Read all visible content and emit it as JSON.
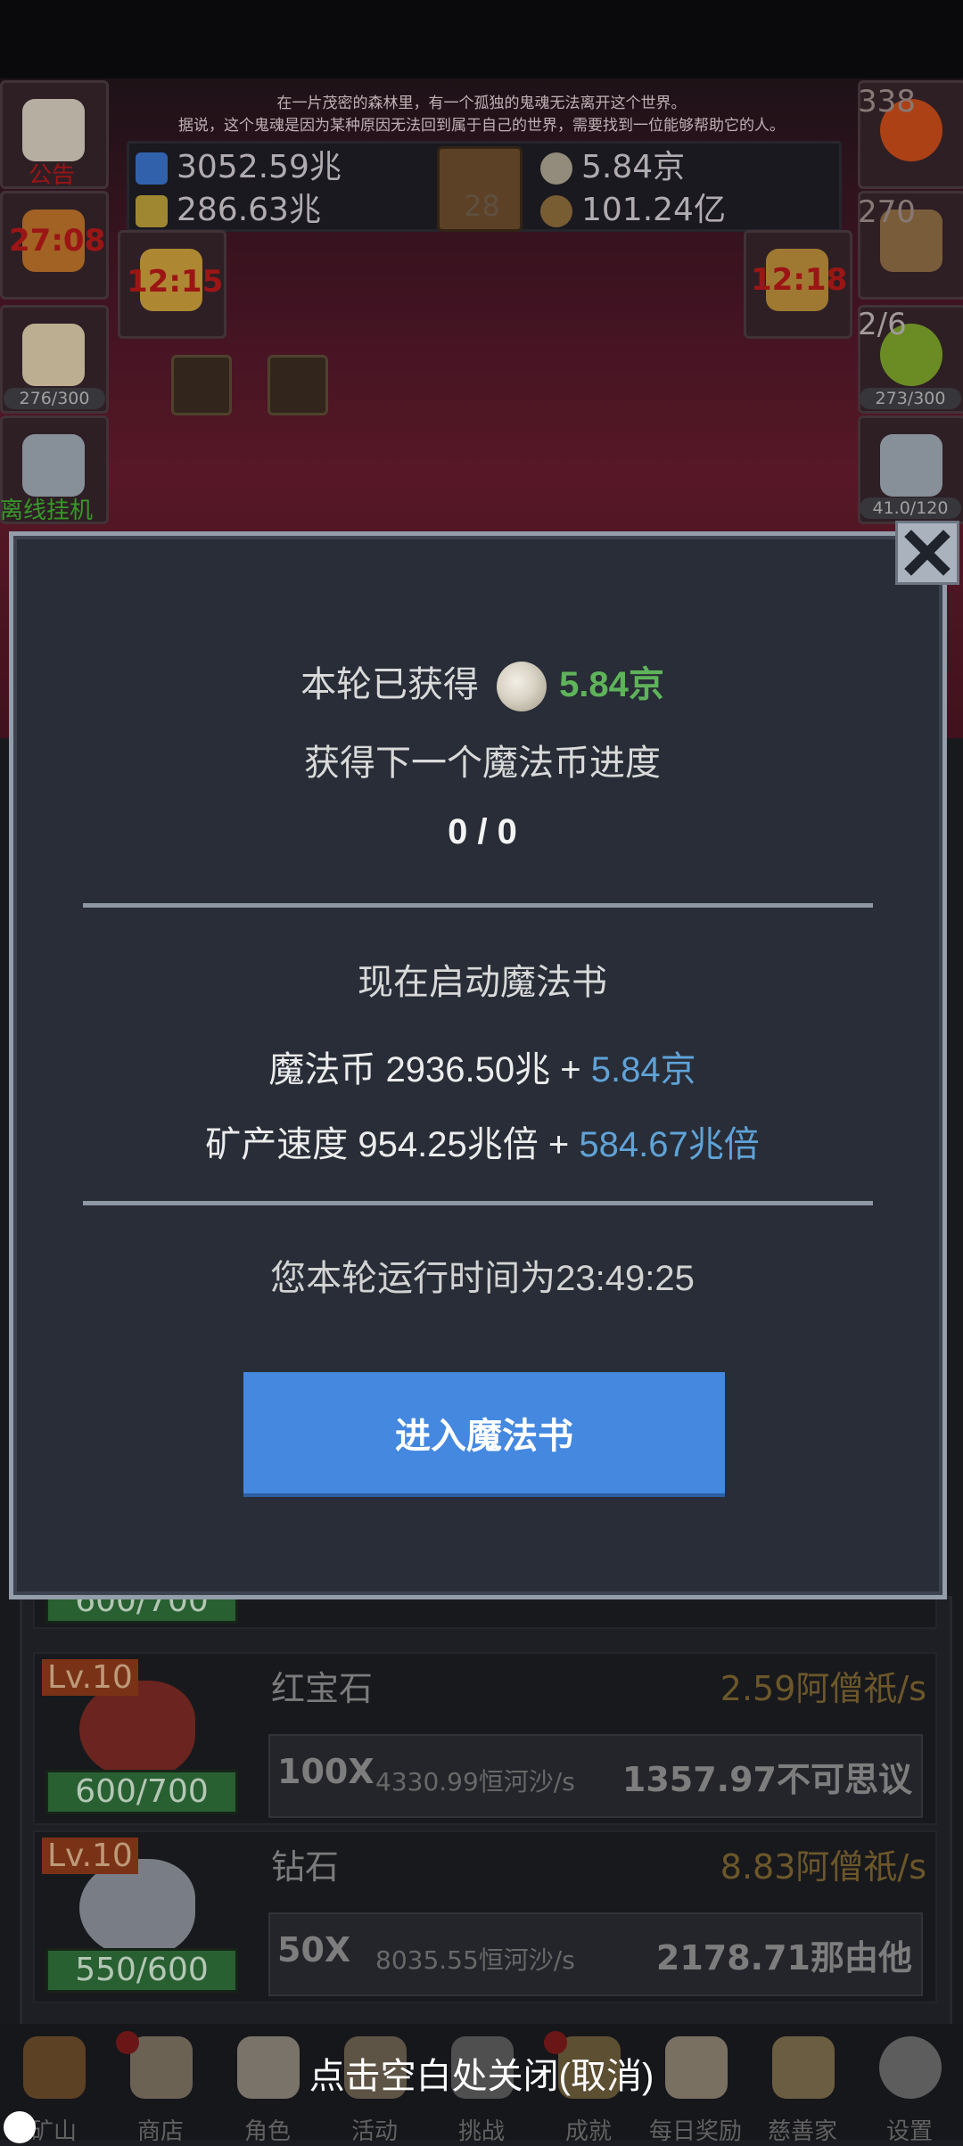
{
  "story": {
    "line1": "在一片茂密的森林里，有一个孤独的鬼魂无法离开这个世界。",
    "line2": "据说，这个鬼魂是因为某种原因无法回到属于自己的世界，需要找到一位能够帮助它的人。"
  },
  "resources": {
    "water": "3052.59兆",
    "potion": "286.63兆",
    "book_level": "28",
    "coin": "5.84京",
    "ore": "101.24亿"
  },
  "left_side": {
    "notice_label": "公告",
    "timer1": "27:08",
    "timer2": "12:15",
    "capacity": "276/300",
    "offline_label": "离线挂机"
  },
  "right_side": {
    "potion_count": "338",
    "chest_count": "270",
    "timer": "12:18",
    "slime_count": "2/6",
    "slime_capacity": "273/300",
    "sword_capacity": "41.0/120"
  },
  "dialog": {
    "earned_label": "本轮已获得",
    "earned_value": "5.84京",
    "progress_label": "获得下一个魔法币进度",
    "progress_value": "0 / 0",
    "start_label": "现在启动魔法书",
    "coin_label": "魔法币 2936.50兆 + ",
    "coin_bonus": "5.84京",
    "speed_label": "矿产速度 954.25兆倍 + ",
    "speed_bonus": "584.67兆倍",
    "runtime": "您本轮运行时间为23:49:25",
    "enter_button": "进入魔法书"
  },
  "mines": [
    {
      "bar": "600/700"
    },
    {
      "level": "Lv.10",
      "name": "红宝石",
      "rate": "2.59阿僧祇/s",
      "bar": "600/700",
      "multiplier": "100X",
      "speed": "4330.99恒河沙/s",
      "cost": "1357.97不可思议",
      "color": "#7a2a24"
    },
    {
      "level": "Lv.10",
      "name": "钻石",
      "rate": "8.83阿僧祇/s",
      "bar": "550/600",
      "multiplier": "50X",
      "speed": "8035.55恒河沙/s",
      "cost": "2178.71那由他",
      "color": "#8a8f98"
    }
  ],
  "nav": [
    "矿山",
    "商店",
    "角色",
    "活动",
    "挑战",
    "成就",
    "每日奖励",
    "慈善家",
    "设置"
  ],
  "tap_to_close": "点击空白处关闭(取消)",
  "icons": {
    "close": "close-icon",
    "coin": "magic-coin-icon"
  },
  "colors": {
    "green_value": "#5fb35a",
    "blue_value": "#5fa3d8",
    "button": "#4488e0"
  }
}
